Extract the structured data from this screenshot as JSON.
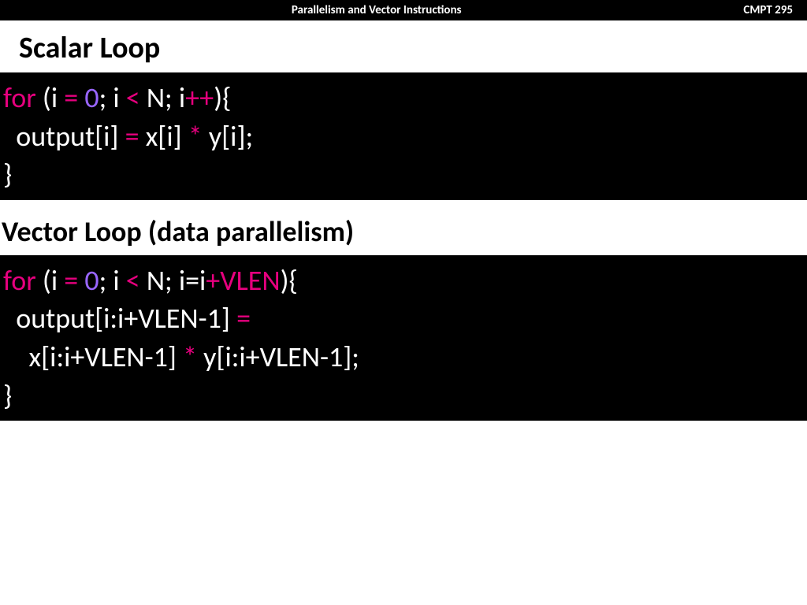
{
  "banner": {
    "title": "Parallelism and Vector Instructions",
    "course": "CMPT 295"
  },
  "section1": {
    "heading": "Scalar Loop",
    "code": {
      "l1": {
        "a": "for ",
        "b": "(i ",
        "c": "= ",
        "d": "0",
        "e": "; i ",
        "f": "< ",
        "g": "N; i",
        "h": "++",
        "i": "){"
      },
      "l2": {
        "a": "  output[i] ",
        "b": "= ",
        "c": "x[i] ",
        "d": "* ",
        "e": "y[i];"
      },
      "l3": {
        "a": "}"
      }
    }
  },
  "section2": {
    "heading": "Vector Loop (data parallelism)",
    "code": {
      "l1": {
        "a": "for ",
        "b": "(i ",
        "c": "= ",
        "d": "0",
        "e": "; i ",
        "f": "< ",
        "g": "N; i=i",
        "h": "+VLEN",
        "i": "){"
      },
      "l2": {
        "a": "  output[i:i+VLEN-1] ",
        "b": "="
      },
      "l3": {
        "a": "    x[i:i+VLEN-1] ",
        "b": "* ",
        "c": "y[i:i+VLEN-1];"
      },
      "l4": {
        "a": "}"
      }
    }
  }
}
